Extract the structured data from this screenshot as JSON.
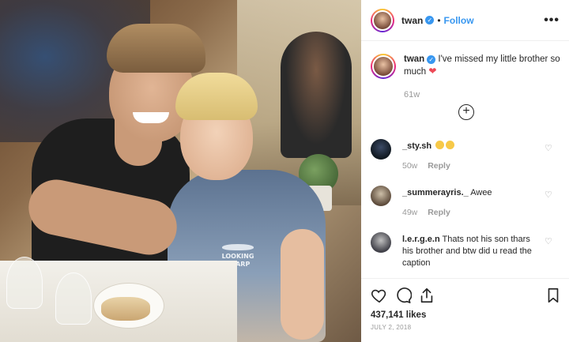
{
  "post": {
    "header": {
      "username": "twan",
      "separator": "•",
      "follow_label": "Follow",
      "more_label": "•••"
    },
    "caption": {
      "username": "twan",
      "text": " I've missed my little brother so much ",
      "emoji": "❤",
      "time": "61w"
    },
    "load_more_label": "+",
    "photo": {
      "shirt_text_line1": "LOOKING",
      "shirt_text_line2": "SHARP"
    },
    "comments": [
      {
        "username": "_sty.sh",
        "text": "",
        "time": "50w",
        "reply_label": "Reply"
      },
      {
        "username": "_summerayris._",
        "text": " Awee",
        "time": "49w",
        "reply_label": "Reply"
      },
      {
        "username": "l.e.r.g.e.n",
        "text": " Thats not his son thars his brother and btw did u read the caption",
        "time": "",
        "reply_label": ""
      }
    ],
    "likes": "437,141 likes",
    "date": "JULY 2, 2018",
    "colors": {
      "link": "#3897f0",
      "heart": "#ed4956",
      "muted": "#999999"
    }
  }
}
